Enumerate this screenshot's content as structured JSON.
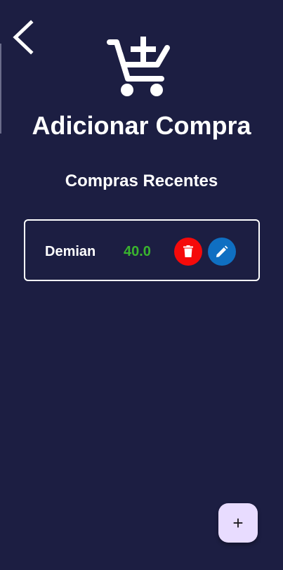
{
  "header": {
    "title": "Adicionar Compra",
    "back_icon": "chevron-left-icon",
    "cart_icon": "add-shopping-cart-icon"
  },
  "section": {
    "title": "Compras Recentes"
  },
  "purchases": [
    {
      "name": "Demian",
      "value": "40.0",
      "delete_icon": "trash-icon",
      "edit_icon": "pencil-icon"
    }
  ],
  "fab": {
    "label": "+"
  },
  "colors": {
    "background": "#1c1e42",
    "value_green": "#3ab42e",
    "delete_red": "#f50a0a",
    "edit_blue": "#0f6fc2",
    "fab_bg": "#e8dcff"
  }
}
